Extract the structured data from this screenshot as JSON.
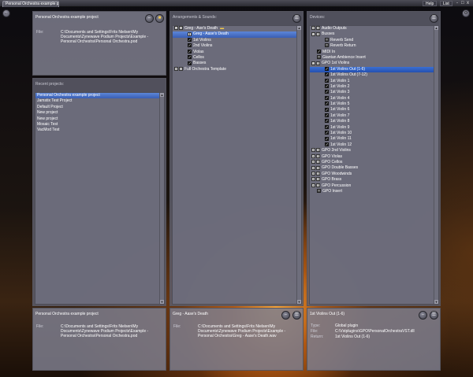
{
  "app": {
    "tab_title": "Personal Orchestra example project",
    "menu_help": "Help",
    "menu_list": "List",
    "win_min": "-",
    "win_max": "□",
    "win_close": "x"
  },
  "project_panel": {
    "title": "Personal Orchestra example project",
    "file_label": "File:",
    "file_value": "C:\\Documents and Settings\\Frits Nielsen\\My Documents\\Zynewave Podium Projects\\Example - Personal Orchestra\\Personal Orchestra.pod"
  },
  "recent_panel": {
    "title": "Recent projects:",
    "items": [
      "Personal Orchestra example project",
      "Jamstix Test Project",
      "Default Project",
      "New project",
      "New project",
      "Mosaic Test",
      "VacMod Test"
    ]
  },
  "recent_detail": {
    "title": "Personal Orchestra example project",
    "file_label": "File:",
    "file_value": "C:\\Documents and Settings\\Frits Nielsen\\My Documents\\Zynewave Podium Projects\\Example - Personal Orchestra\\Personal Orchestra.pod"
  },
  "arrangements_panel": {
    "title": "Arrangements & Sounds:",
    "items": [
      {
        "label": "Greg - Ase's Death",
        "depth": 0,
        "toggle": "-",
        "icon": "song",
        "folder": true
      },
      {
        "label": "Greg - Aase's Death",
        "depth": 1,
        "toggle": "",
        "icon": "audio",
        "selected": true
      },
      {
        "label": "1st Violins",
        "depth": 1,
        "toggle": "",
        "icon": "track"
      },
      {
        "label": "2nd Violins",
        "depth": 1,
        "toggle": "",
        "icon": "track"
      },
      {
        "label": "Violas",
        "depth": 1,
        "toggle": "",
        "icon": "track"
      },
      {
        "label": "Cellos",
        "depth": 1,
        "toggle": "",
        "icon": "track"
      },
      {
        "label": "Basses",
        "depth": 1,
        "toggle": "",
        "icon": "track"
      },
      {
        "label": "Full Orchestra Template",
        "depth": 0,
        "toggle": "+",
        "icon": "song"
      }
    ]
  },
  "arrangement_detail": {
    "title": "Greg - Aase's Death",
    "file_label": "File:",
    "file_value": "C:\\Documents and Settings\\Frits Nielsen\\My Documents\\Zynewave Podium Projects\\Example - Personal Orchestra\\Greg - Aase's Death.wav"
  },
  "devices_panel": {
    "title": "Devices:",
    "items": [
      {
        "label": "Audio Outputs",
        "depth": 0,
        "toggle": "+",
        "icon": "audio"
      },
      {
        "label": "Busses",
        "depth": 0,
        "toggle": "-",
        "icon": "audio"
      },
      {
        "label": "Reverb Send",
        "depth": 1,
        "toggle": "",
        "icon": "fx"
      },
      {
        "label": "Reverb Return",
        "depth": 1,
        "toggle": "",
        "icon": "fx"
      },
      {
        "label": "MIDI In",
        "depth": 0,
        "toggle": "",
        "icon": "track"
      },
      {
        "label": "Giantan Ambience Insert",
        "depth": 0,
        "toggle": "",
        "icon": "fx"
      },
      {
        "label": "GPO 1st Violins",
        "depth": 0,
        "toggle": "-",
        "icon": "audio"
      },
      {
        "label": "1st Violins Out (1-6)",
        "depth": 1,
        "toggle": "",
        "icon": "track",
        "selected": true
      },
      {
        "label": "1st Violins Out (7-12)",
        "depth": 1,
        "toggle": "",
        "icon": "track"
      },
      {
        "label": "1st Violin 1",
        "depth": 1,
        "toggle": "",
        "icon": "track"
      },
      {
        "label": "1st Violin 2",
        "depth": 1,
        "toggle": "",
        "icon": "track"
      },
      {
        "label": "1st Violin 3",
        "depth": 1,
        "toggle": "",
        "icon": "track"
      },
      {
        "label": "1st Violin 4",
        "depth": 1,
        "toggle": "",
        "icon": "track"
      },
      {
        "label": "1st Violin 5",
        "depth": 1,
        "toggle": "",
        "icon": "track"
      },
      {
        "label": "1st Violin 6",
        "depth": 1,
        "toggle": "",
        "icon": "track"
      },
      {
        "label": "1st Violin 7",
        "depth": 1,
        "toggle": "",
        "icon": "track"
      },
      {
        "label": "1st Violin 8",
        "depth": 1,
        "toggle": "",
        "icon": "track"
      },
      {
        "label": "1st Violin 9",
        "depth": 1,
        "toggle": "",
        "icon": "track"
      },
      {
        "label": "1st Violin 10",
        "depth": 1,
        "toggle": "",
        "icon": "track"
      },
      {
        "label": "1st Violin 11",
        "depth": 1,
        "toggle": "",
        "icon": "track"
      },
      {
        "label": "1st Violin 12",
        "depth": 1,
        "toggle": "",
        "icon": "track"
      },
      {
        "label": "GPO 2nd Violins",
        "depth": 0,
        "toggle": "+",
        "icon": "audio"
      },
      {
        "label": "GPO Violas",
        "depth": 0,
        "toggle": "+",
        "icon": "audio"
      },
      {
        "label": "GPO Cellos",
        "depth": 0,
        "toggle": "+",
        "icon": "audio"
      },
      {
        "label": "GPO Double Basses",
        "depth": 0,
        "toggle": "+",
        "icon": "audio"
      },
      {
        "label": "GPO Woodwinds",
        "depth": 0,
        "toggle": "+",
        "icon": "audio"
      },
      {
        "label": "GPO Brass",
        "depth": 0,
        "toggle": "+",
        "icon": "audio"
      },
      {
        "label": "GPO Percussion",
        "depth": 0,
        "toggle": "+",
        "icon": "audio"
      },
      {
        "label": "GPO Insert",
        "depth": 0,
        "toggle": "",
        "icon": "fx"
      }
    ]
  },
  "device_detail": {
    "title": "1st Violins Out (1-6)",
    "type_label": "Type:",
    "type_value": "Global plugin",
    "file_label": "File:",
    "file_value": "C:\\Vstplugins\\GPO\\PersonalOrchestraVST.dll",
    "return_label": "Return:",
    "return_value": "1st Violins Out (1-6)"
  }
}
